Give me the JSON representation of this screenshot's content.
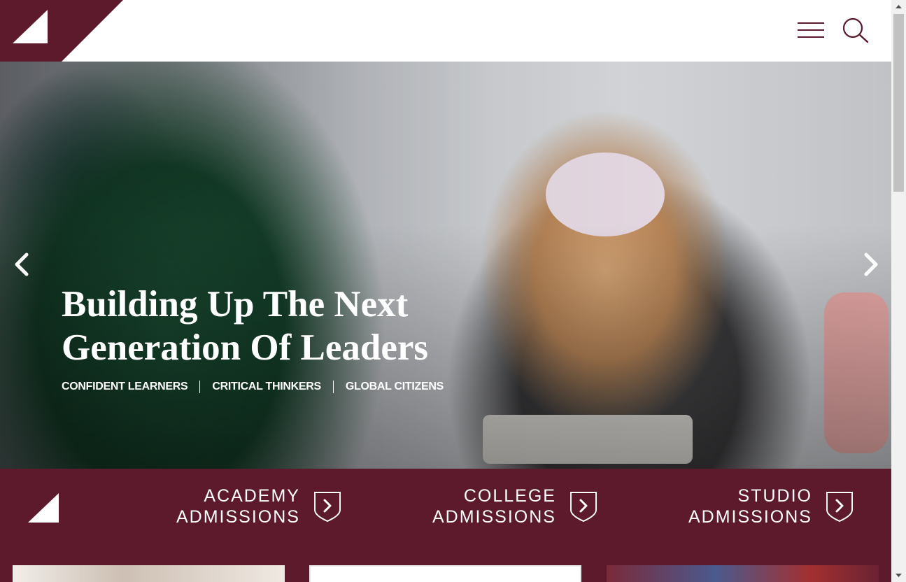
{
  "header": {
    "menu_icon": "hamburger-icon",
    "search_icon": "search-icon",
    "brand_color": "#5c1a2c"
  },
  "hero": {
    "title": "Building Up The Next Generation Of Leaders",
    "tags": [
      "CONFIDENT LEARNERS",
      "CRITICAL THINKERS",
      "GLOBAL CITIZENS"
    ],
    "prev_icon": "chevron-left-icon",
    "next_icon": "chevron-right-icon"
  },
  "admissions": {
    "items": [
      {
        "line1": "ACADEMY",
        "line2": "ADMISSIONS",
        "icon": "chevron-right-shield-icon"
      },
      {
        "line1": "COLLEGE",
        "line2": "ADMISSIONS",
        "icon": "chevron-right-shield-icon"
      },
      {
        "line1": "STUDIO",
        "line2": "ADMISSIONS",
        "icon": "chevron-right-shield-icon"
      }
    ]
  }
}
